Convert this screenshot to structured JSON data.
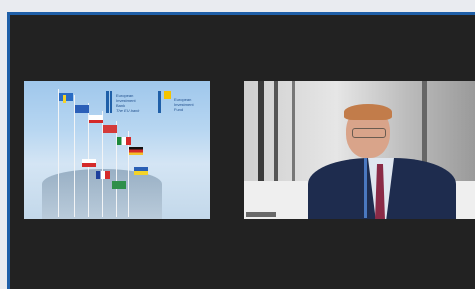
{
  "meeting": {
    "tiles": [
      {
        "kind": "shared-screen",
        "logo_lines_1": [
          "European",
          "Investment",
          "Bank"
        ],
        "logo_tagline": "The EU bank",
        "logo_lines_2": [
          "European",
          "Investment",
          "Fund"
        ]
      },
      {
        "kind": "camera-feed",
        "name_tag": ""
      }
    ]
  },
  "colors": {
    "accent": "#1f5fa8",
    "stage_background": "#222222",
    "page_background": "#e9ebf0"
  }
}
